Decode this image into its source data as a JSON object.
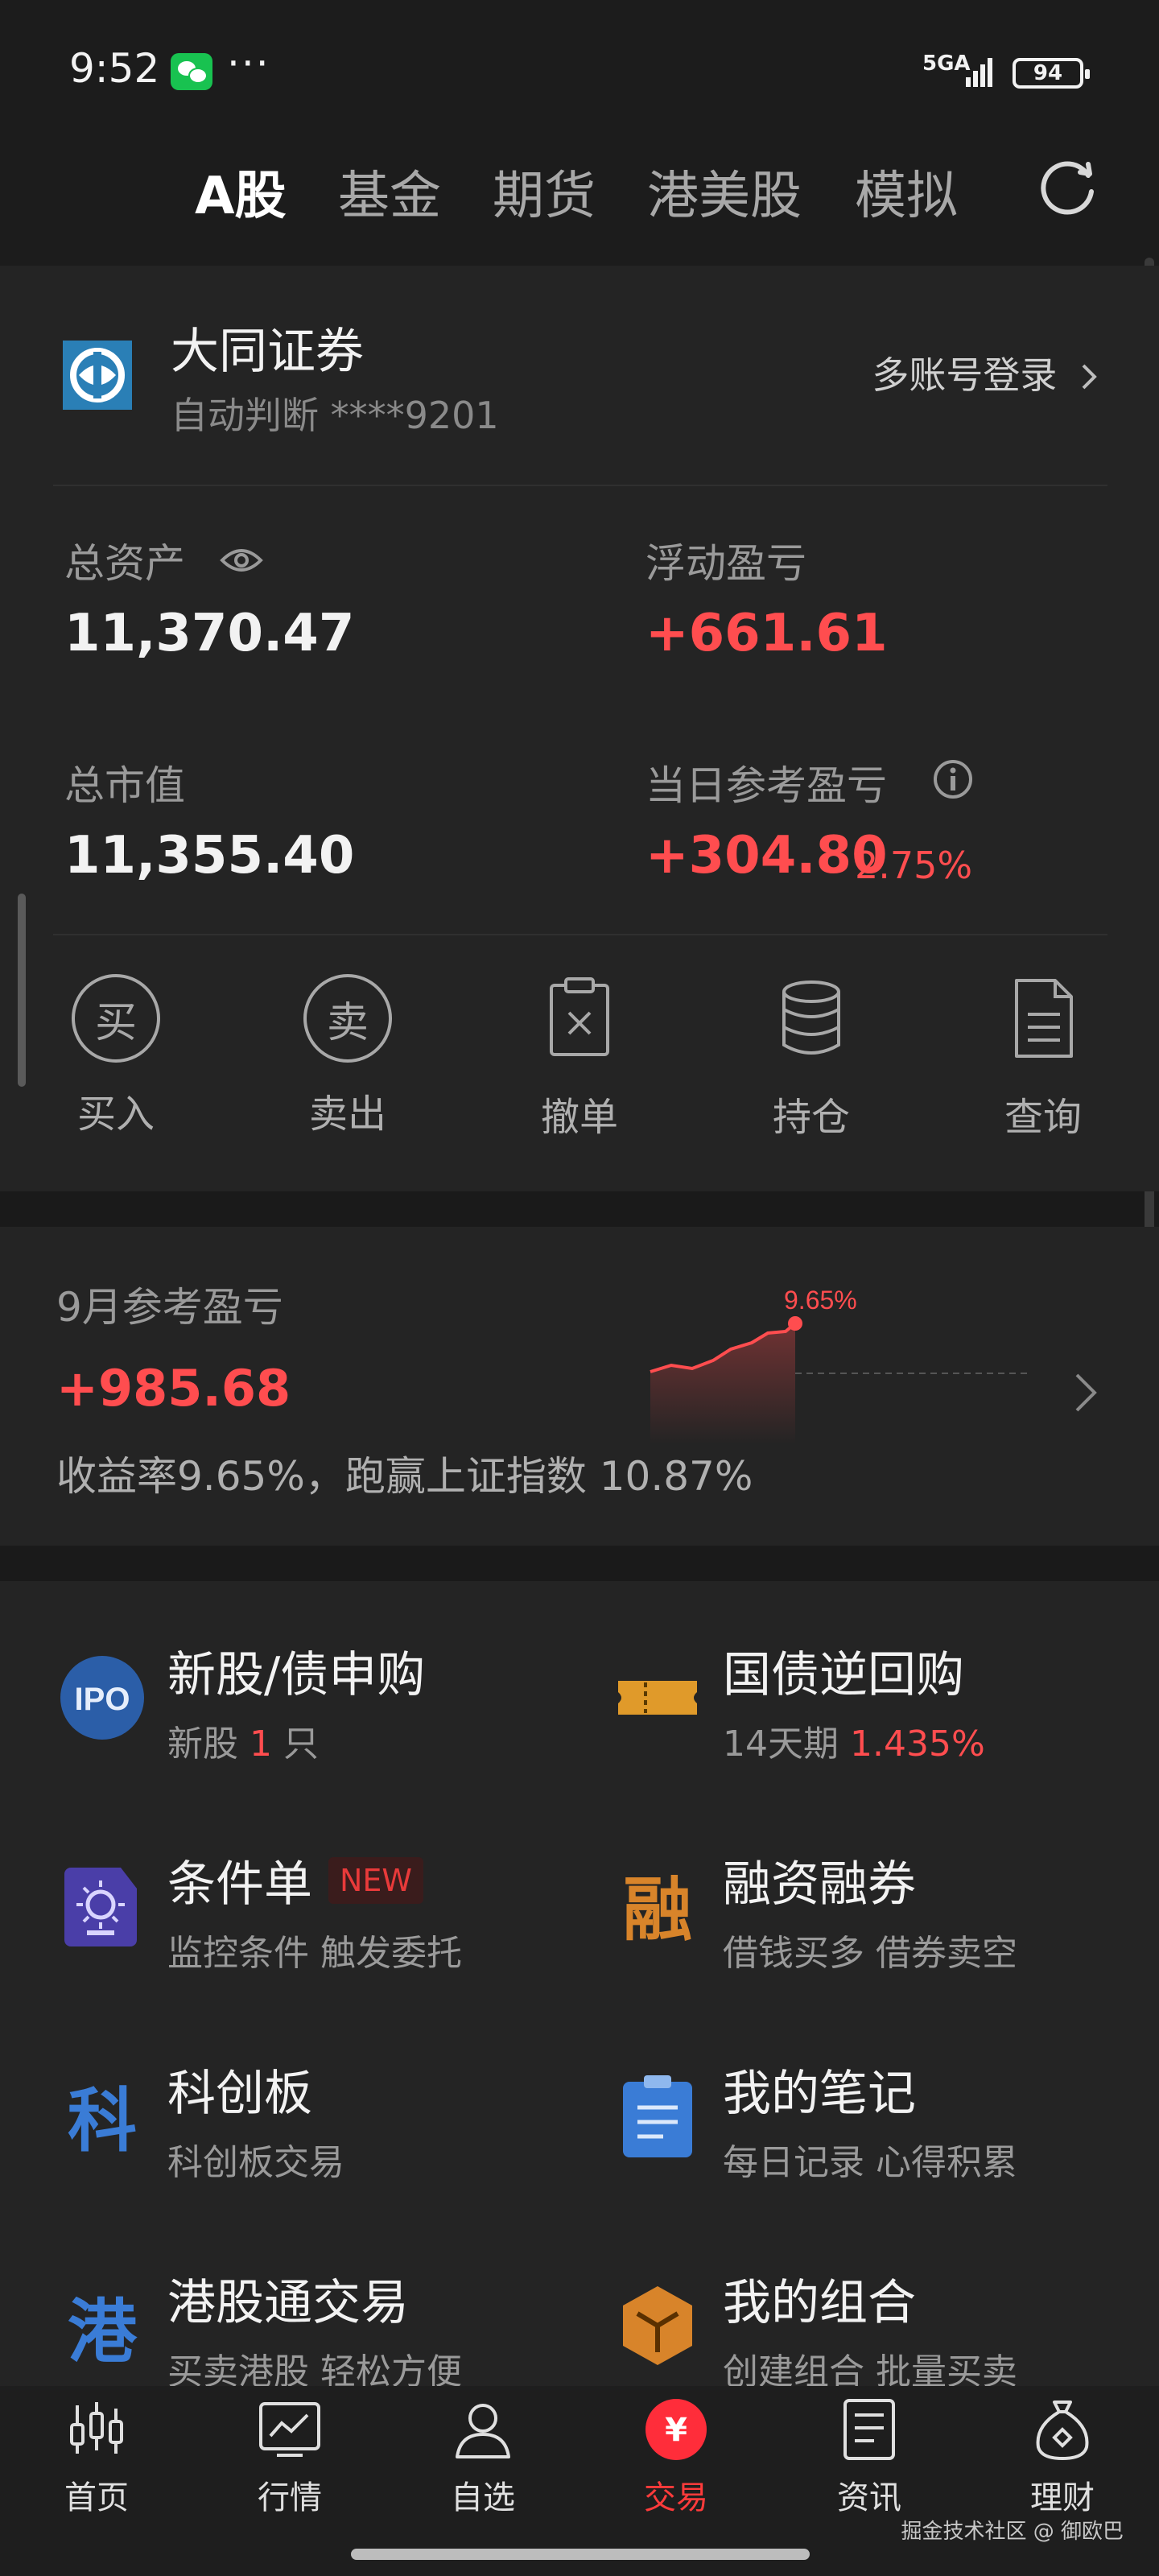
{
  "status_bar": {
    "time": "9:52",
    "more": "···",
    "network": "5GA",
    "battery": "94"
  },
  "tabs": [
    {
      "label": "A股",
      "active": true
    },
    {
      "label": "基金",
      "active": false
    },
    {
      "label": "期货",
      "active": false
    },
    {
      "label": "港美股",
      "active": false
    },
    {
      "label": "模拟",
      "active": false
    }
  ],
  "account": {
    "broker_name": "大同证券",
    "account_sub": "自动判断 ****9201",
    "multi_login": "多账号登录",
    "total_assets_label": "总资产",
    "total_assets": "11,370.47",
    "floating_pl_label": "浮动盈亏",
    "floating_pl": "+661.61",
    "market_value_label": "总市值",
    "market_value": "11,355.40",
    "daily_pl_label": "当日参考盈亏",
    "daily_pl": "+304.80",
    "daily_pl_pct": "2.75%"
  },
  "actions": [
    {
      "label": "买入",
      "glyph": "买",
      "icon": "buy-icon"
    },
    {
      "label": "卖出",
      "glyph": "卖",
      "icon": "sell-icon"
    },
    {
      "label": "撤单",
      "icon": "cancel-order-icon"
    },
    {
      "label": "持仓",
      "icon": "holdings-icon"
    },
    {
      "label": "查询",
      "icon": "query-icon"
    }
  ],
  "monthly": {
    "label": "9月参考盈亏",
    "value": "+985.68",
    "desc": "收益率9.65%，跑赢上证指数 10.87%",
    "chart_label": "9.65%"
  },
  "services": [
    {
      "title": "新股/债申购",
      "sub_pre": "新股 ",
      "sub_hl": "1",
      "sub_post": " 只",
      "icon": "ipo-icon"
    },
    {
      "title": "国债逆回购",
      "sub_pre": "14天期 ",
      "sub_hl": "1.435%",
      "sub_post": "",
      "icon": "ticket-icon"
    },
    {
      "title": "条件单",
      "badge": "NEW",
      "sub_pre": "监控条件 触发委托",
      "sub_hl": "",
      "sub_post": "",
      "icon": "condition-order-icon"
    },
    {
      "title": "融资融券",
      "sub_pre": "借钱买多 借券卖空",
      "sub_hl": "",
      "sub_post": "",
      "icon": "margin-icon",
      "glyph": "融"
    },
    {
      "title": "科创板",
      "sub_pre": "科创板交易",
      "sub_hl": "",
      "sub_post": "",
      "icon": "star-market-icon",
      "glyph": "科"
    },
    {
      "title": "我的笔记",
      "sub_pre": "每日记录 心得积累",
      "sub_hl": "",
      "sub_post": "",
      "icon": "notes-icon"
    },
    {
      "title": "港股通交易",
      "sub_pre": "买卖港股 轻松方便",
      "sub_hl": "",
      "sub_post": "",
      "icon": "hk-connect-icon",
      "glyph": "港"
    },
    {
      "title": "我的组合",
      "sub_pre": "创建组合 批量买卖",
      "sub_hl": "",
      "sub_post": "",
      "icon": "portfolio-icon"
    }
  ],
  "nav": [
    {
      "label": "首页",
      "icon": "home-icon",
      "active": false
    },
    {
      "label": "行情",
      "icon": "market-icon",
      "active": false
    },
    {
      "label": "自选",
      "icon": "watchlist-icon",
      "active": false
    },
    {
      "label": "交易",
      "icon": "trade-icon",
      "active": true,
      "glyph": "¥"
    },
    {
      "label": "资讯",
      "icon": "news-icon",
      "active": false
    },
    {
      "label": "理财",
      "icon": "wealth-icon",
      "active": false
    }
  ],
  "watermark": "掘金技术社区 @ 御欧巴",
  "colors": {
    "accent_red": "#ff4d4f",
    "background": "#1a1a1a",
    "card": "#242424"
  }
}
